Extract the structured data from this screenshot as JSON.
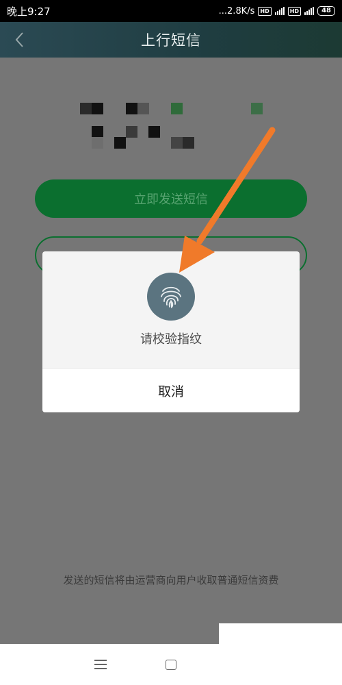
{
  "status_bar": {
    "time": "晚上9:27",
    "speed": "...2.8K/s",
    "hd_badge": "HD",
    "network": "4G",
    "battery": "48"
  },
  "header": {
    "title": "上行短信"
  },
  "main": {
    "send_button_label": "立即发送短信",
    "footer_note": "发送的短信将由运营商向用户收取普通短信资费"
  },
  "dialog": {
    "message": "请校验指纹",
    "cancel_label": "取消"
  },
  "colors": {
    "accent_green": "#0b6f2f",
    "arrow": "#f07a2a"
  },
  "icons": [
    "back-icon",
    "fingerprint-icon",
    "menu-icon",
    "home-icon"
  ]
}
